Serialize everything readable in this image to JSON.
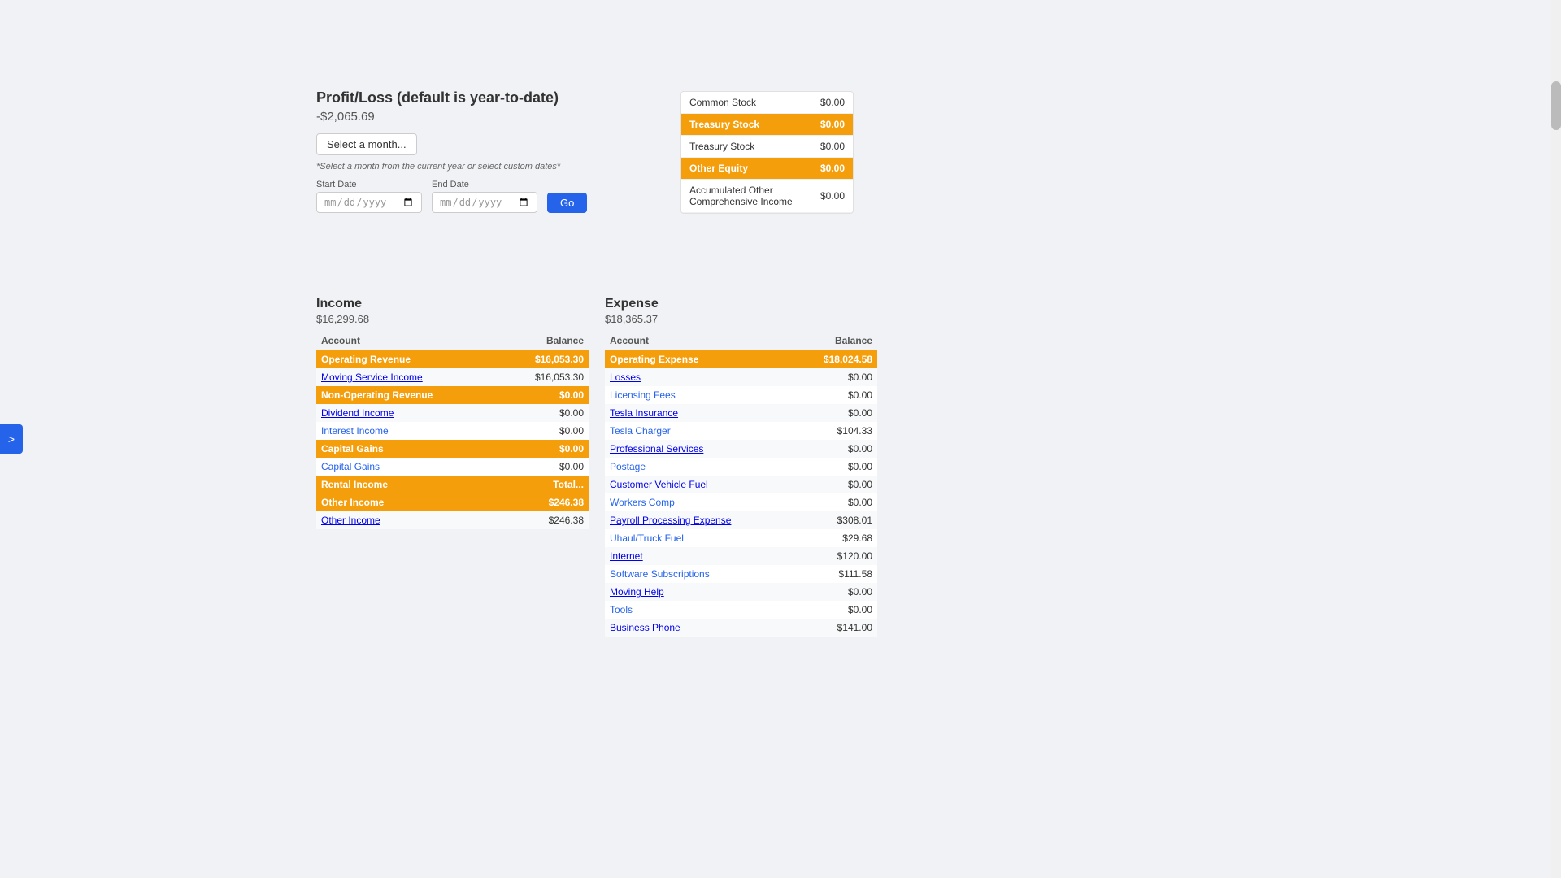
{
  "page": {
    "title": "Profit/Loss",
    "subtitle": "(default is year-to-date)"
  },
  "sidebar_toggle": {
    "label": ">"
  },
  "top_right_panel": {
    "rows": [
      {
        "label": "Common Stock",
        "amount": "$0.00",
        "highlight": false
      },
      {
        "label": "Treasury Stock",
        "amount": "$0.00",
        "highlight": true
      },
      {
        "label": "Treasury Stock",
        "amount": "$0.00",
        "highlight": false
      },
      {
        "label": "Other Equity",
        "amount": "$0.00",
        "highlight": true
      },
      {
        "label": "Accumulated Other Comprehensive Income",
        "amount": "$0.00",
        "highlight": false
      }
    ]
  },
  "profit_loss": {
    "title": "Profit/Loss (default is year-to-date)",
    "value": "-$2,065.69",
    "month_select_label": "Select a month...",
    "hint": "*Select a month from the current year or select custom dates*",
    "start_date_label": "Start Date",
    "end_date_label": "End Date",
    "start_date_placeholder": "mm/dd/yyyy",
    "end_date_placeholder": "mm/dd/yyyy",
    "go_label": "Go"
  },
  "income": {
    "heading": "Income",
    "total": "$16,299.68",
    "account_col": "Account",
    "balance_col": "Balance",
    "rows": [
      {
        "label": "Operating Revenue",
        "amount": "$16,053.30",
        "highlight": true,
        "is_link": false
      },
      {
        "label": "Moving Service Income",
        "amount": "$16,053.30",
        "highlight": false,
        "is_link": true
      },
      {
        "label": "Non-Operating Revenue",
        "amount": "$0.00",
        "highlight": true,
        "is_link": false
      },
      {
        "label": "Dividend Income",
        "amount": "$0.00",
        "highlight": false,
        "is_link": true
      },
      {
        "label": "Interest Income",
        "amount": "$0.00",
        "highlight": false,
        "is_link": true
      },
      {
        "label": "Capital Gains",
        "amount": "$0.00",
        "highlight": true,
        "is_link": false
      },
      {
        "label": "Capital Gains",
        "amount": "$0.00",
        "highlight": false,
        "is_link": true
      },
      {
        "label": "Rental Income",
        "amount": "Total...",
        "highlight": true,
        "is_link": false
      },
      {
        "label": "Other Income",
        "amount": "$246.38",
        "highlight": true,
        "is_link": false
      },
      {
        "label": "Other Income",
        "amount": "$246.38",
        "highlight": false,
        "is_link": true
      }
    ]
  },
  "expense": {
    "heading": "Expense",
    "total": "$18,365.37",
    "account_col": "Account",
    "balance_col": "Balance",
    "rows": [
      {
        "label": "Operating Expense",
        "amount": "$18,024.58",
        "highlight": true,
        "is_link": false
      },
      {
        "label": "Losses",
        "amount": "$0.00",
        "highlight": false,
        "is_link": true
      },
      {
        "label": "Licensing Fees",
        "amount": "$0.00",
        "highlight": false,
        "is_link": true
      },
      {
        "label": "Tesla Insurance",
        "amount": "$0.00",
        "highlight": false,
        "is_link": true
      },
      {
        "label": "Tesla Charger",
        "amount": "$104.33",
        "highlight": false,
        "is_link": true
      },
      {
        "label": "Professional Services",
        "amount": "$0.00",
        "highlight": false,
        "is_link": true
      },
      {
        "label": "Postage",
        "amount": "$0.00",
        "highlight": false,
        "is_link": true
      },
      {
        "label": "Customer Vehicle Fuel",
        "amount": "$0.00",
        "highlight": false,
        "is_link": true
      },
      {
        "label": "Workers Comp",
        "amount": "$0.00",
        "highlight": false,
        "is_link": true
      },
      {
        "label": "Payroll Processing Expense",
        "amount": "$308.01",
        "highlight": false,
        "is_link": true
      },
      {
        "label": "Uhaul/Truck Fuel",
        "amount": "$29.68",
        "highlight": false,
        "is_link": true
      },
      {
        "label": "Internet",
        "amount": "$120.00",
        "highlight": false,
        "is_link": true
      },
      {
        "label": "Software Subscriptions",
        "amount": "$111.58",
        "highlight": false,
        "is_link": true
      },
      {
        "label": "Moving Help",
        "amount": "$0.00",
        "highlight": false,
        "is_link": true
      },
      {
        "label": "Tools",
        "amount": "$0.00",
        "highlight": false,
        "is_link": true
      },
      {
        "label": "Business Phone",
        "amount": "$141.00",
        "highlight": false,
        "is_link": true
      }
    ]
  }
}
